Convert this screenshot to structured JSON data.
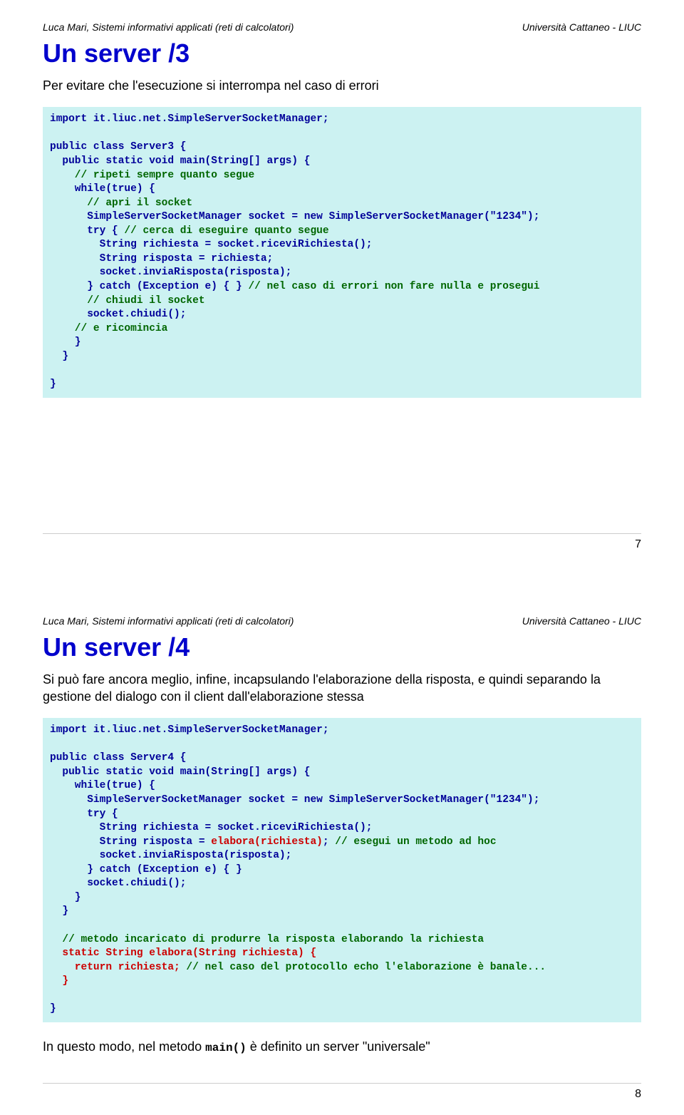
{
  "slide1": {
    "header_left": "Luca Mari, Sistemi informativi applicati (reti di calcolatori)",
    "header_right": "Università Cattaneo - LIUC",
    "title": "Un server /3",
    "subtitle": "Per evitare che l'esecuzione si interrompa nel caso di errori",
    "page_number": "7",
    "code": {
      "l01": "import it.liuc.net.SimpleServerSocketManager;",
      "l02": "",
      "l03": "public class Server3 {",
      "l04": "  public static void main(String[] args) {",
      "l05c": "    // ripeti sempre quanto segue",
      "l06": "    while(true) {",
      "l07c": "      // apri il socket",
      "l08": "      SimpleServerSocketManager socket = new SimpleServerSocketManager(\"1234\");",
      "l09a": "      try {",
      "l09c": " // cerca di eseguire quanto segue",
      "l10": "        String richiesta = socket.riceviRichiesta();",
      "l11": "        String risposta = richiesta;",
      "l12": "        socket.inviaRisposta(risposta);",
      "l13a": "      } catch (Exception e) { }",
      "l13c": " // nel caso di errori non fare nulla e prosegui",
      "l14c": "      // chiudi il socket",
      "l15": "      socket.chiudi();",
      "l16c": "    // e ricomincia",
      "l17": "    }",
      "l18": "  }",
      "l19": "",
      "l20": "}"
    }
  },
  "slide2": {
    "header_left": "Luca Mari, Sistemi informativi applicati (reti di calcolatori)",
    "header_right": "Università Cattaneo - LIUC",
    "title": "Un server /4",
    "subtitle": "Si può fare ancora meglio, infine, incapsulando l'elaborazione della risposta, e quindi separando la gestione del dialogo con il client dall'elaborazione stessa",
    "page_number": "8",
    "note_before": "In questo modo, nel metodo ",
    "note_code": "main()",
    "note_after": " è definito un server \"universale\"",
    "code": {
      "l01": "import it.liuc.net.SimpleServerSocketManager;",
      "l02": "",
      "l03": "public class Server4 {",
      "l04": "  public static void main(String[] args) {",
      "l05": "    while(true) {",
      "l06": "      SimpleServerSocketManager socket = new SimpleServerSocketManager(\"1234\");",
      "l07": "      try {",
      "l08": "        String richiesta = socket.riceviRichiesta();",
      "l09a": "        String risposta = ",
      "l09h": "elabora(richiesta)",
      "l09b": ";",
      "l09c": " // esegui un metodo ad hoc",
      "l10": "        socket.inviaRisposta(risposta);",
      "l11": "      } catch (Exception e) { }",
      "l12": "      socket.chiudi();",
      "l13": "    }",
      "l14": "  }",
      "l15": "",
      "l16c": "  // metodo incaricato di produrre la risposta elaborando la richiesta",
      "l17h": "  static String elabora(String richiesta) {",
      "l18a": "    return richiesta;",
      "l18c": " // nel caso del protocollo echo l'elaborazione è banale...",
      "l19h": "  }",
      "l20": "",
      "l21": "}"
    }
  }
}
